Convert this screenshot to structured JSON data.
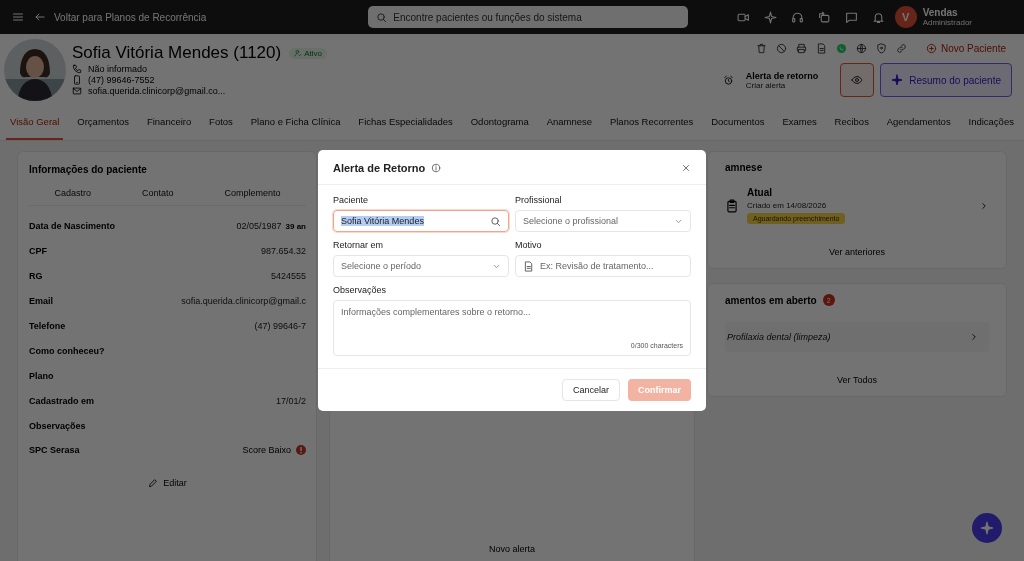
{
  "topbar": {
    "back_label": "Voltar para Planos de Recorrência",
    "search": {
      "placeholder": "Encontre pacientes ou funções do sistema"
    },
    "user": {
      "initial": "V",
      "name": "Vendas",
      "role": "Administrador"
    }
  },
  "patient": {
    "name": "Sofia Vitória Mendes (1120)",
    "status": "Ativo",
    "contacts": [
      {
        "kind": "phone",
        "text": "Não informado"
      },
      {
        "kind": "mobile",
        "text": "(47) 99646-7552"
      },
      {
        "kind": "email",
        "text": "sofia.querida.clinicorp@gmail.co..."
      }
    ]
  },
  "header_actions": {
    "new_patient": "Novo Paciente",
    "alert": {
      "title": "Alerta de retorno",
      "subtitle": "Criar alerta"
    },
    "summary": "Resumo do paciente"
  },
  "tabs": [
    {
      "label": "Visão Geral",
      "selected": true
    },
    {
      "label": "Orçamentos",
      "selected": false
    },
    {
      "label": "Financeiro",
      "selected": false
    },
    {
      "label": "Fotos",
      "selected": false
    },
    {
      "label": "Plano e Ficha Clínica",
      "selected": false
    },
    {
      "label": "Fichas Especialidades",
      "selected": false
    },
    {
      "label": "Odontograma",
      "selected": false
    },
    {
      "label": "Anamnese",
      "selected": false
    },
    {
      "label": "Planos Recorrentes",
      "selected": false
    },
    {
      "label": "Documentos",
      "selected": false
    },
    {
      "label": "Exames",
      "selected": false
    },
    {
      "label": "Recibos",
      "selected": false
    },
    {
      "label": "Agendamentos",
      "selected": false
    },
    {
      "label": "Indicações",
      "selected": false
    }
  ],
  "patient_info": {
    "title": "Informações do paciente",
    "subtabs": [
      "Cadastro",
      "Contato",
      "Complemento"
    ],
    "rows": [
      {
        "label": "Data de Nascimento",
        "value": "02/05/1987",
        "extra": "39 an"
      },
      {
        "label": "CPF",
        "value": "987.654.32"
      },
      {
        "label": "RG",
        "value": "5424555"
      },
      {
        "label": "Email",
        "value": "sofia.querida.clinicorp@gmail.c"
      },
      {
        "label": "Telefone",
        "value": "(47) 99646-7"
      },
      {
        "label": "Como conheceu?"
      },
      {
        "label": "Plano"
      },
      {
        "label": "Cadastrado em",
        "value": "17/01/2"
      },
      {
        "label": "Observações"
      },
      {
        "label": "SPC Serasa",
        "value": "Score Baixo",
        "alert": true
      }
    ],
    "edit": "Editar"
  },
  "alerts_card": {
    "new_alert": "Novo alerta"
  },
  "anamnese": {
    "title": "amnese",
    "item": {
      "title": "Atual",
      "subtitle": "Criado em 14/08/2026",
      "badge": "Aguardando preenchimento"
    },
    "more": "Ver anteriores"
  },
  "budgets": {
    "title": "amentos em aberto",
    "count": "2",
    "items": [
      "Profilaxia dental (limpeza)"
    ],
    "more": "Ver Todos"
  },
  "modal": {
    "title": "Alerta de Retorno",
    "fields": [
      {
        "kind": "search",
        "label": "Paciente",
        "value": "Sofia Vitória Mendes",
        "focused": true
      },
      {
        "kind": "select",
        "label": "Profissional",
        "placeholder": "Selecione o profissional",
        "focused": false
      },
      {
        "kind": "select",
        "label": "Retornar em",
        "placeholder": "Selecione o período",
        "focused": false
      },
      {
        "kind": "text",
        "label": "Motivo",
        "placeholder": "Ex: Revisão de tratamento...",
        "focused": false
      }
    ],
    "notes": {
      "label": "Observações",
      "placeholder": "Informações complementares sobre o retorno...",
      "counter": "0/300 characters"
    },
    "cancel": "Cancelar",
    "confirm": {
      "label": "Confirmar",
      "disabled": true
    }
  }
}
